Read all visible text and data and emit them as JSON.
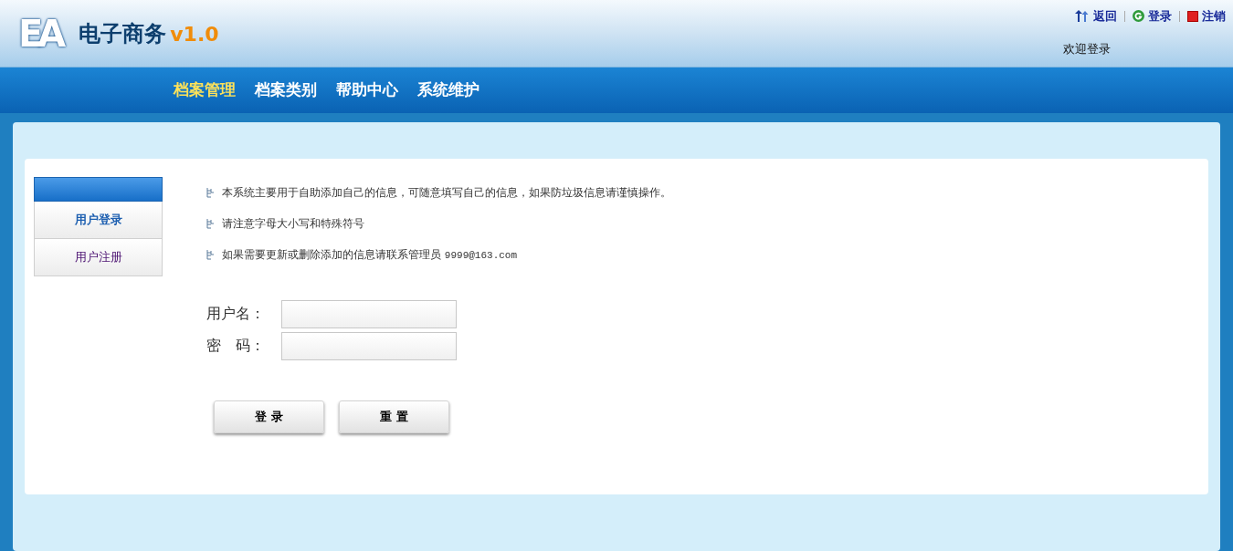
{
  "logo": {
    "mark": "EA",
    "title": "电子商务",
    "version": "v1.0"
  },
  "top_links": [
    {
      "kind": "back",
      "label": "返回"
    },
    {
      "kind": "login",
      "label": "登录"
    },
    {
      "kind": "logout",
      "label": "注销"
    }
  ],
  "welcome": "欢迎登录",
  "nav": [
    {
      "label": "档案管理",
      "selected": true
    },
    {
      "label": "档案类别",
      "selected": false
    },
    {
      "label": "帮助中心",
      "selected": false
    },
    {
      "label": "系统维护",
      "selected": false
    }
  ],
  "sidebar": [
    {
      "label": "用户登录",
      "selected": true
    },
    {
      "label": "用户注册",
      "selected": false
    }
  ],
  "notes": [
    {
      "text": "本系统主要用于自助添加自己的信息，可随意填写自己的信息，如果防垃圾信息请谨慎操作。"
    },
    {
      "text": "请注意字母大小写和特殊符号"
    },
    {
      "text": "如果需要更新或删除添加的信息请联系管理员",
      "email": "9999@163.com"
    }
  ],
  "fields": [
    {
      "label": "用户名："
    },
    {
      "label": "密　码："
    }
  ],
  "buttons": [
    "登 录",
    "重 置"
  ]
}
